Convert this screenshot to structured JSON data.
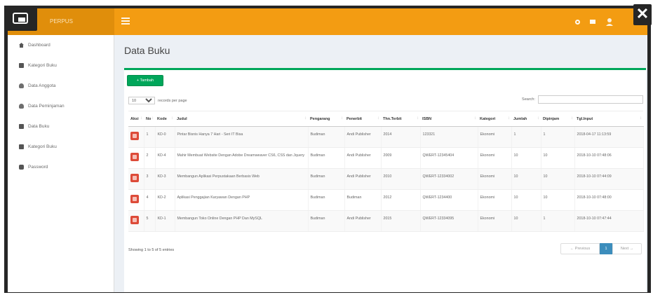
{
  "header": {
    "app_name": "PERPUS",
    "menu_icon": "hamburger-icon",
    "icons": [
      "bell-icon",
      "envelope-icon",
      "user-icon"
    ],
    "close_label": "✕"
  },
  "sidebar": {
    "items": [
      {
        "label": "Dashboard",
        "icon": "home-icon"
      },
      {
        "label": "Kategori Buku",
        "icon": "book-icon"
      },
      {
        "label": "Data Anggota",
        "icon": "user-icon"
      },
      {
        "label": "Data Peminjaman",
        "icon": "users-icon"
      },
      {
        "label": "Data Buku",
        "icon": "book-icon"
      },
      {
        "label": "Kategori Buku",
        "icon": "book-icon"
      },
      {
        "label": "Password",
        "icon": "lock-icon"
      }
    ]
  },
  "main": {
    "title": "Data Buku",
    "add_button": "+ Tambah",
    "length_value": "10",
    "length_suffix": "records per page",
    "search_label": "Search:",
    "columns": [
      "Aksi",
      "No",
      "Kode",
      "Judul",
      "Pengarang",
      "Penerbit",
      "Thn.Terbit",
      "ISBN",
      "Kategori",
      "Jumlah",
      "Dipinjam",
      "Tgl.Input"
    ],
    "rows": [
      {
        "no": "1",
        "kode": "KD-0",
        "judul": "Pintar Bisnis Hanya 7 Hari - Seri IT Bisa",
        "pengarang": "Budiman",
        "penerbit": "Andi Publisher",
        "tahun": "2014",
        "isbn": "123321",
        "kategori": "Ekonomi",
        "jumlah": "1",
        "dipinjam": "1",
        "tgl": "2018-04-17 11:13:59"
      },
      {
        "no": "2",
        "kode": "KD-4",
        "judul": "Mahir Membuat Website Dengan Adobe Dreamweaver CS6, CSS dan Jquery",
        "pengarang": "Budiman",
        "penerbit": "Andi Publisher",
        "tahun": "2009",
        "isbn": "QWERT-12345404",
        "kategori": "Ekonomi",
        "jumlah": "10",
        "dipinjam": "10",
        "tgl": "2018-10-10 07:48:06"
      },
      {
        "no": "3",
        "kode": "KD-3",
        "judul": "Membangun Aplikasi Perpustakaan Berbasis Web",
        "pengarang": "Budiman",
        "penerbit": "Andi Publisher",
        "tahun": "2010",
        "isbn": "QWERT-12334002",
        "kategori": "Ekonomi",
        "jumlah": "10",
        "dipinjam": "10",
        "tgl": "2018-10-10 07:44:09"
      },
      {
        "no": "4",
        "kode": "KD-2",
        "judul": "Aplikasi Penggajian Karyawan Dengan PHP",
        "pengarang": "Budiman",
        "penerbit": "Budiman",
        "tahun": "2012",
        "isbn": "QWERT-1234400",
        "kategori": "Ekonomi",
        "jumlah": "10",
        "dipinjam": "10",
        "tgl": "2018-10-10 07:48:00"
      },
      {
        "no": "5",
        "kode": "KD-1",
        "judul": "Membangun Toko Online Dengan PHP Dan MySQL",
        "pengarang": "Budiman",
        "penerbit": "Andi Publisher",
        "tahun": "2015",
        "isbn": "QWERT-12334095",
        "kategori": "Ekonomi",
        "jumlah": "10",
        "dipinjam": "1",
        "tgl": "2018-10-10 07:47:44"
      }
    ],
    "showing": "Showing 1 to 5 of 5 entries",
    "pagination": {
      "previous": "← Previous",
      "page": "1",
      "next": "Next →"
    }
  },
  "colors": {
    "header": "#f39c12",
    "logo_bg": "#e08e0b",
    "success": "#00a65a",
    "danger": "#dd4b39",
    "primary": "#3c8dbc"
  }
}
